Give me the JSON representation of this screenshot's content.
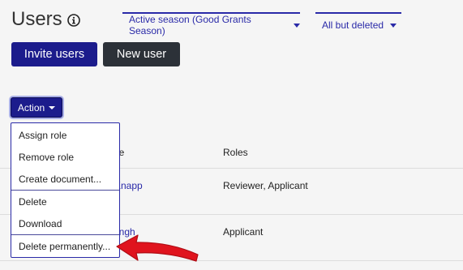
{
  "header": {
    "title": "Users",
    "info_icon": "info-circle-icon"
  },
  "filters": {
    "season": "Active season (Good Grants Season)",
    "status": "All but deleted"
  },
  "toolbar": {
    "invite_label": "Invite users",
    "new_user_label": "New user"
  },
  "action": {
    "label": "Action",
    "menu": [
      "Assign role",
      "Remove role",
      "Create document...",
      "Delete",
      "Download",
      "Delete permanently..."
    ]
  },
  "table": {
    "columns": [
      "ne",
      "Roles"
    ],
    "rows": [
      {
        "name_fragment": "Knapp",
        "roles": "Reviewer, Applicant"
      },
      {
        "name_fragment": "ingh",
        "roles": "Applicant"
      }
    ]
  },
  "colors": {
    "primary": "#1c1c8c",
    "dark": "#2c3138",
    "arrow": "#e0141e"
  }
}
